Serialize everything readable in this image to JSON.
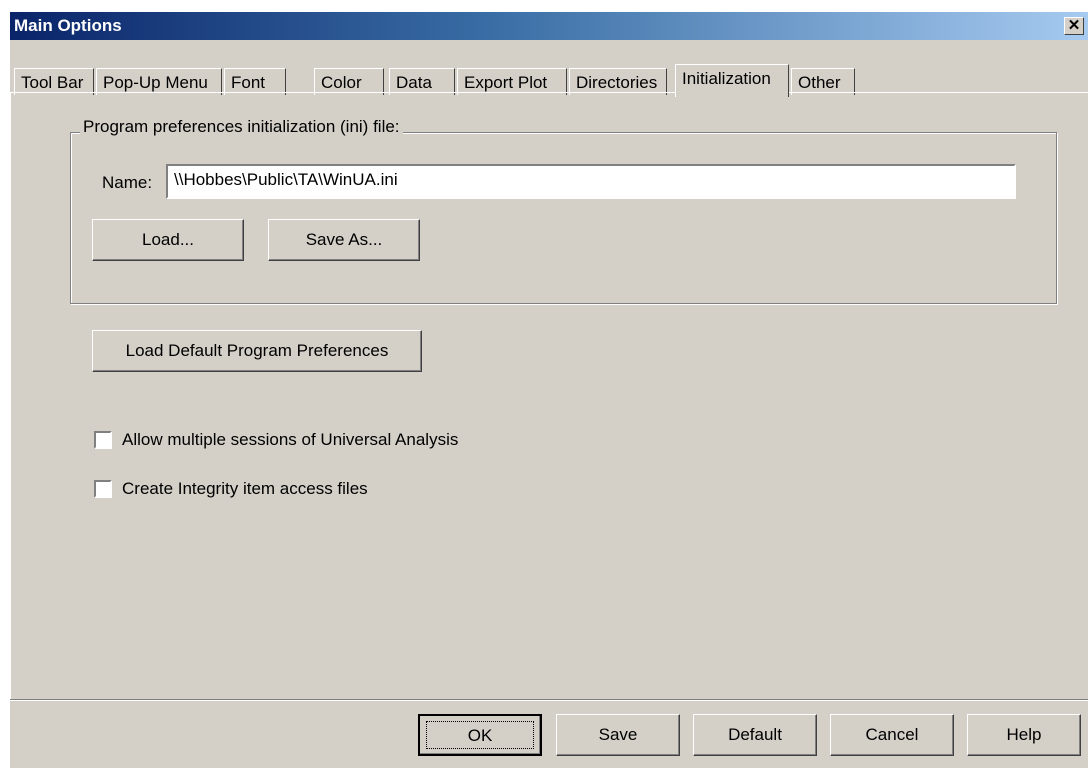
{
  "window": {
    "title": "Main Options",
    "close_glyph": "✕"
  },
  "tabs": [
    {
      "label": "Tool Bar"
    },
    {
      "label": "Pop-Up Menu"
    },
    {
      "label": "Font"
    },
    {
      "label": "Color"
    },
    {
      "label": "Data"
    },
    {
      "label": "Export Plot"
    },
    {
      "label": "Directories"
    },
    {
      "label": "Initialization",
      "active": true
    },
    {
      "label": "Other"
    }
  ],
  "ini_group": {
    "label": "Program preferences initialization (ini) file:",
    "name_label": "Name:",
    "name_value": "\\\\Hobbes\\Public\\TA\\WinUA.ini",
    "load_label": "Load...",
    "save_as_label": "Save As..."
  },
  "load_default_label": "Load Default Program Preferences",
  "checkboxes": [
    {
      "label": "Allow multiple sessions of Universal Analysis",
      "checked": false
    },
    {
      "label": "Create Integrity item access files",
      "checked": false
    }
  ],
  "footer": {
    "ok_label": "OK",
    "save_label": "Save",
    "default_label": "Default",
    "cancel_label": "Cancel",
    "help_label": "Help"
  }
}
